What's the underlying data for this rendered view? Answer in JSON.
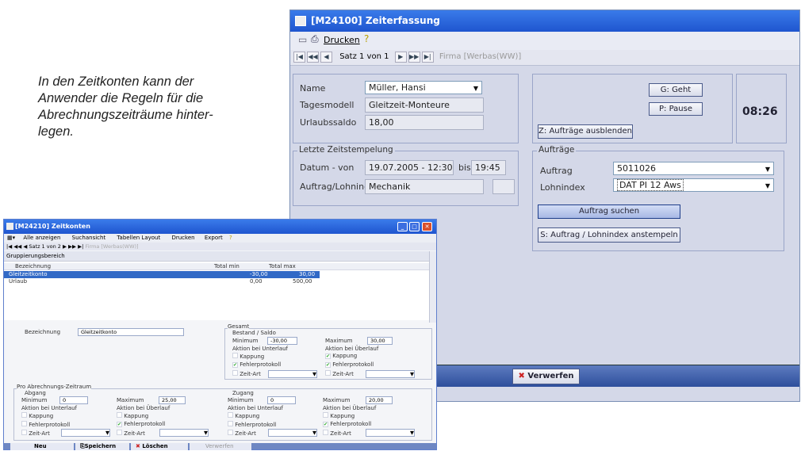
{
  "caption": "In den Zeitkonten kann der Anwender die Regeln für die Abrechnungszeiträume hinter-legen.",
  "caption_lines": [
    "In den Zeitkonten kann der",
    "Anwender die Regeln für die",
    "Abrechnungszeiträume hinter-",
    "legen."
  ],
  "zeit": {
    "title": "[M24100]  Zeiterfassung",
    "toolbar": {
      "print": "Drucken"
    },
    "nav": {
      "record": "Satz 1 von 1",
      "firma": "Firma [Werbas(WW)]"
    },
    "name_label": "Name",
    "name_value": "Müller, Hansi",
    "tagesmodell_label": "Tagesmodell",
    "tagesmodell_value": "Gleitzeit-Monteure",
    "urlaub_label": "Urlaubssaldo",
    "urlaub_value": "18,00",
    "geht": "G: Geht",
    "pause": "P: Pause",
    "time": "08:26",
    "hide_orders": "Z: Aufträge ausblenden",
    "letzte_title": "Letzte Zeitstempelung",
    "datum_label": "Datum - von",
    "datum_value": "19.07.2005 - 12:30",
    "bis_label": "bis",
    "bis_value": "19:45",
    "auftrag_lohn_label": "Auftrag/Lohnind.",
    "auftrag_lohn_value": "Mechanik",
    "auftraege_title": "Aufträge",
    "auftrag_label": "Auftrag",
    "auftrag_value": "5011026",
    "lohnindex_label": "Lohnindex",
    "lohnindex_value": "DAT PI 12 Aws",
    "search": "Auftrag suchen",
    "stamp": "S: Auftrag / Lohnindex  anstempeln",
    "discard": "Verwerfen"
  },
  "konten": {
    "title": "[M24210]  Zeitkonten",
    "toolbar": {
      "show_all": "Alle anzeigen",
      "search_view": "Suchansicht",
      "layout": "Tabellen Layout",
      "print": "Drucken",
      "export": "Export"
    },
    "nav": {
      "record": "Satz 1 von 2",
      "firma": "Firma [Werbas(WW)]"
    },
    "grouping": "Gruppierungsbereich",
    "columns": [
      "Bezeichnung",
      "Total min",
      "Total max"
    ],
    "rows": [
      {
        "name": "Gleitzeitkonto",
        "min": "-30,00",
        "max": "30,00"
      },
      {
        "name": "Urlaub",
        "min": "0,00",
        "max": "500,00"
      }
    ],
    "bez_label": "Bezeichnung",
    "bez_value": "Gleitzeitkonto",
    "gesamt": "Gesamt",
    "bestand": "Bestand / Saldo",
    "minimum": "Minimum",
    "maximum": "Maximum",
    "g_min": "-30,00",
    "g_max": "30,00",
    "unterlauf": "Aktion bei Unterlauf",
    "ueberlauf": "Aktion bei Überlauf",
    "kappung": "Kappung",
    "fehler": "Fehlerprotokoll",
    "zeitart": "Zeit-Art",
    "pro": "Pro Abrechnungs-Zeitraum",
    "abgang": "Abgang",
    "zugang": "Zugang",
    "a_min": "0",
    "a_max": "25,00",
    "z_min": "0",
    "z_max": "20,00",
    "neu": "Neu",
    "speichern": "Speichern",
    "loeschen": "Löschen",
    "verwerfen": "Verwerfen"
  }
}
